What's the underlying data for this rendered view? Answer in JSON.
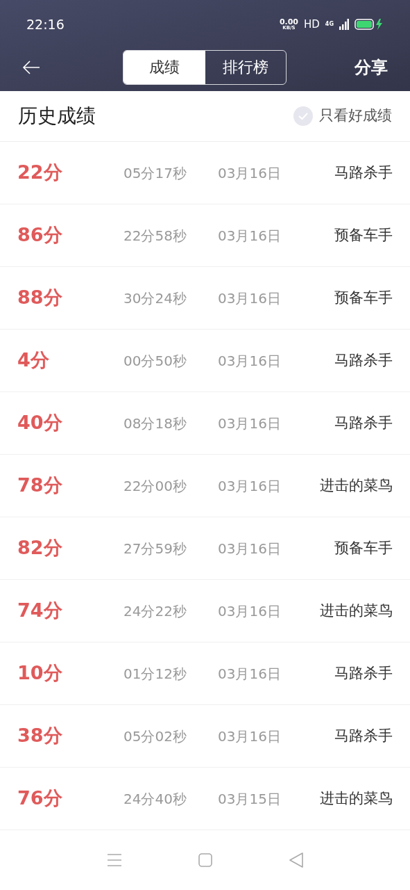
{
  "status_bar": {
    "time": "22:16",
    "speed": "0.00",
    "speed_unit": "KB/S",
    "hd": "HD",
    "network": "4G"
  },
  "header": {
    "tabs": [
      {
        "label": "成绩",
        "selected": true
      },
      {
        "label": "排行榜",
        "selected": false
      }
    ],
    "share": "分享"
  },
  "section": {
    "title": "历史成绩",
    "filter": {
      "label": "只看好成绩",
      "checked": false
    }
  },
  "rows": [
    {
      "score": "22分",
      "duration": "05分17秒",
      "date": "03月16日",
      "rank": "马路杀手"
    },
    {
      "score": "86分",
      "duration": "22分58秒",
      "date": "03月16日",
      "rank": "预备车手"
    },
    {
      "score": "88分",
      "duration": "30分24秒",
      "date": "03月16日",
      "rank": "预备车手"
    },
    {
      "score": "4分",
      "duration": "00分50秒",
      "date": "03月16日",
      "rank": "马路杀手"
    },
    {
      "score": "40分",
      "duration": "08分18秒",
      "date": "03月16日",
      "rank": "马路杀手"
    },
    {
      "score": "78分",
      "duration": "22分00秒",
      "date": "03月16日",
      "rank": "进击的菜鸟"
    },
    {
      "score": "82分",
      "duration": "27分59秒",
      "date": "03月16日",
      "rank": "预备车手"
    },
    {
      "score": "74分",
      "duration": "24分22秒",
      "date": "03月16日",
      "rank": "进击的菜鸟"
    },
    {
      "score": "10分",
      "duration": "01分12秒",
      "date": "03月16日",
      "rank": "马路杀手"
    },
    {
      "score": "38分",
      "duration": "05分02秒",
      "date": "03月16日",
      "rank": "马路杀手"
    },
    {
      "score": "76分",
      "duration": "24分40秒",
      "date": "03月15日",
      "rank": "进击的菜鸟"
    }
  ]
}
